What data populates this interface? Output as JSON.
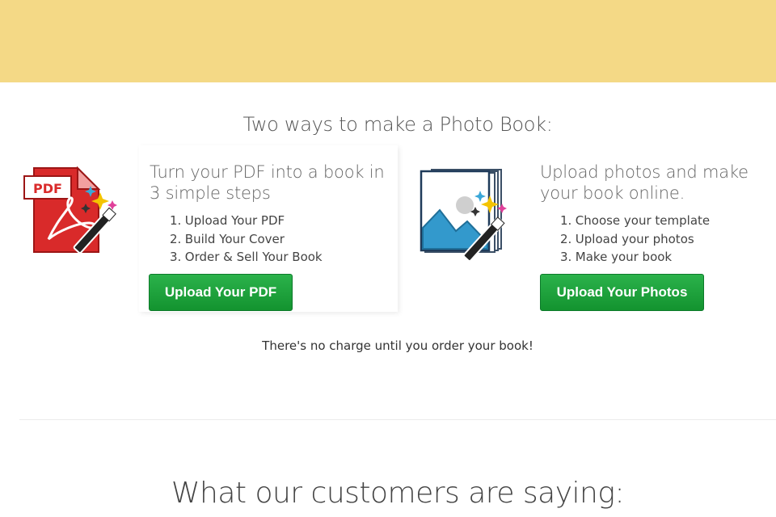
{
  "header": {
    "banner_color": "#f4d986"
  },
  "section": {
    "title": "Two ways to make a Photo Book:"
  },
  "options": [
    {
      "icon": "pdf-magic-wand-icon",
      "heading": "Turn your PDF into a book in 3 simple steps",
      "steps": [
        "Upload Your PDF",
        "Build Your Cover",
        "Order & Sell Your Book"
      ],
      "button_label": "Upload Your PDF"
    },
    {
      "icon": "photo-book-magic-wand-icon",
      "heading": "Upload photos and make your book online.",
      "steps": [
        "Choose your template",
        "Upload your photos",
        "Make your book"
      ],
      "button_label": "Upload Your Photos"
    }
  ],
  "note": "There's no charge until you order your book!",
  "testimonials": {
    "title": "What our customers are saying:"
  },
  "colors": {
    "cta_green": "#13932f",
    "pdf_red": "#d92a2a",
    "photo_blue": "#3399cc"
  }
}
